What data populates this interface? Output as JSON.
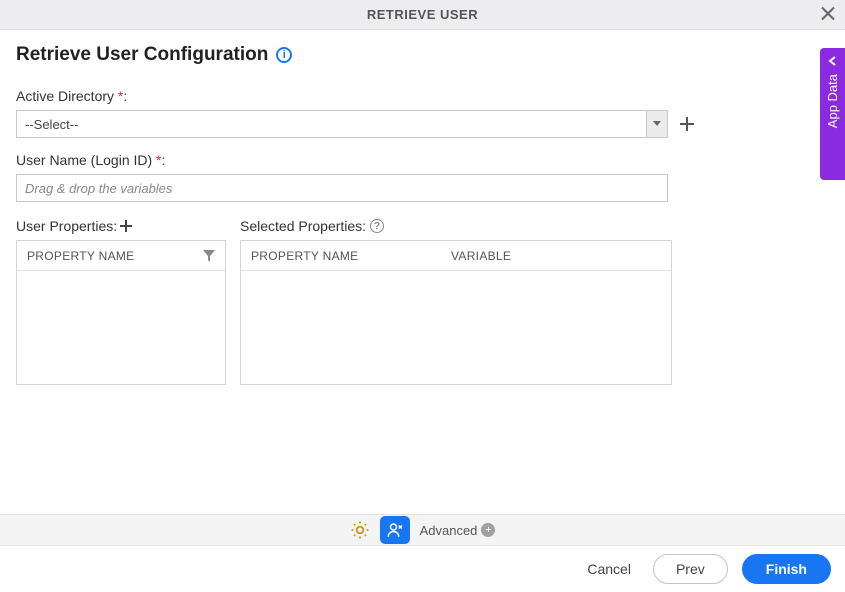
{
  "header": {
    "title": "RETRIEVE USER"
  },
  "page": {
    "title": "Retrieve User Configuration"
  },
  "fields": {
    "active_directory": {
      "label": "Active Directory",
      "value": "--Select--"
    },
    "user_name": {
      "label": "User Name (Login ID)",
      "placeholder": "Drag & drop the variables"
    }
  },
  "user_properties": {
    "label": "User Properties:",
    "header": "PROPERTY NAME"
  },
  "selected_properties": {
    "label": "Selected Properties:",
    "header_name": "PROPERTY NAME",
    "header_var": "VARIABLE"
  },
  "toolbar": {
    "advanced_label": "Advanced"
  },
  "footer": {
    "cancel": "Cancel",
    "prev": "Prev",
    "finish": "Finish"
  },
  "side_tab": {
    "label": "App Data"
  },
  "required_mark": " *",
  "colon": ":"
}
